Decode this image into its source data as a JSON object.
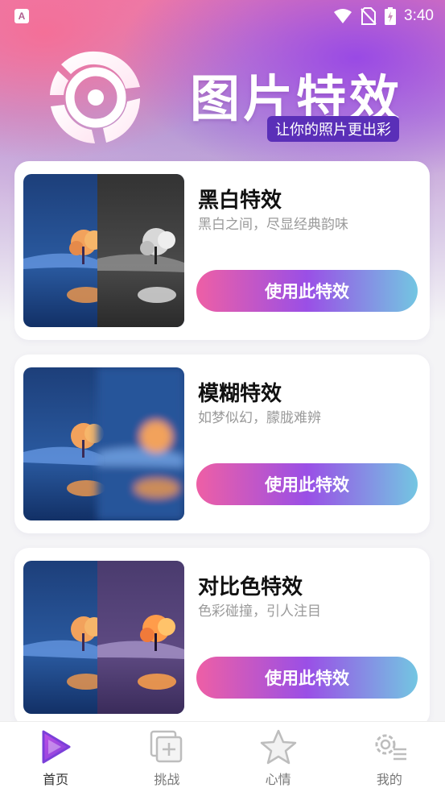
{
  "status_bar": {
    "app_icon_letter": "A",
    "time": "3:40"
  },
  "header": {
    "title": "图片特效",
    "tagline": "让你的照片更出彩"
  },
  "effects": [
    {
      "title": "黑白特效",
      "subtitle": "黑白之间，尽显经典韵味",
      "button_label": "使用此特效"
    },
    {
      "title": "模糊特效",
      "subtitle": "如梦似幻，朦胧难辨",
      "button_label": "使用此特效"
    },
    {
      "title": "对比色特效",
      "subtitle": "色彩碰撞，引人注目",
      "button_label": "使用此特效"
    }
  ],
  "tabbar": {
    "items": [
      {
        "label": "首页",
        "icon": "play-icon",
        "active": true
      },
      {
        "label": "挑战",
        "icon": "add-square-icon",
        "active": false
      },
      {
        "label": "心情",
        "icon": "star-icon",
        "active": false
      },
      {
        "label": "我的",
        "icon": "settings-icon",
        "active": false
      }
    ]
  },
  "colors": {
    "accent_pink": "#ee5fa5",
    "accent_purple": "#9a4fe6",
    "accent_cyan": "#73c6e2",
    "tagline_bg": "#5a2fb8"
  }
}
